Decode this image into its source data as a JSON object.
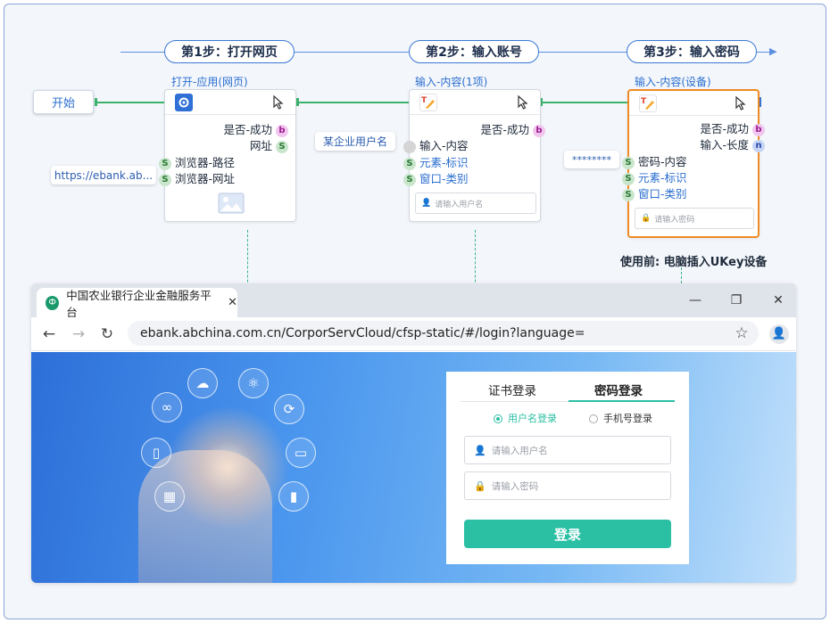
{
  "steps": [
    {
      "label": "第1步：打开网页"
    },
    {
      "label": "第2步：输入账号"
    },
    {
      "label": "第3步：输入密码"
    }
  ],
  "start": {
    "label": "开始"
  },
  "nodes": {
    "open_app": {
      "title": "打开-应用(网页)",
      "outputs": [
        {
          "label": "是否-成功",
          "type": "b"
        },
        {
          "label": "网址",
          "type": "S"
        }
      ],
      "inputs": [
        {
          "label": "浏览器-路径",
          "type": "S"
        },
        {
          "label": "浏览器-网址",
          "type": "S"
        }
      ]
    },
    "input_account": {
      "title": "输入-内容(1项)",
      "outputs": [
        {
          "label": "是否-成功",
          "type": "b"
        }
      ],
      "inputs": [
        {
          "label": "输入-内容",
          "type": ""
        },
        {
          "label": "元素-标识",
          "type": "S"
        },
        {
          "label": "窗口-类别",
          "type": "S"
        }
      ],
      "preview_placeholder": "请输入用户名"
    },
    "input_password": {
      "title": "输入-内容(设备)",
      "outputs": [
        {
          "label": "是否-成功",
          "type": "b"
        },
        {
          "label": "输入-长度",
          "type": "n"
        }
      ],
      "inputs": [
        {
          "label": "密码-内容",
          "type": "S"
        },
        {
          "label": "元素-标识",
          "type": "S"
        },
        {
          "label": "窗口-类别",
          "type": "S"
        }
      ],
      "preview_placeholder": "请输入密码"
    }
  },
  "pills": {
    "url": "https://ebank.ab...",
    "username": "某企业用户名",
    "password": "********"
  },
  "note": "使用前: 电脑插入UKey设备",
  "browser": {
    "tab_title": "中国农业银行企业金融服务平台",
    "address": "ebank.abchina.com.cn/CorporServCloud/cfsp-static/#/login?language=",
    "login": {
      "tabs": [
        "证书登录",
        "密码登录"
      ],
      "radio": [
        "用户名登录",
        "手机号登录"
      ],
      "username_placeholder": "请输入用户名",
      "password_placeholder": "请输入密码",
      "submit": "登录"
    }
  },
  "colors": {
    "accent_blue": "#3a78d4",
    "connector_green": "#3bb36a",
    "active_orange": "#f08a24",
    "login_teal": "#2bbfa4"
  }
}
